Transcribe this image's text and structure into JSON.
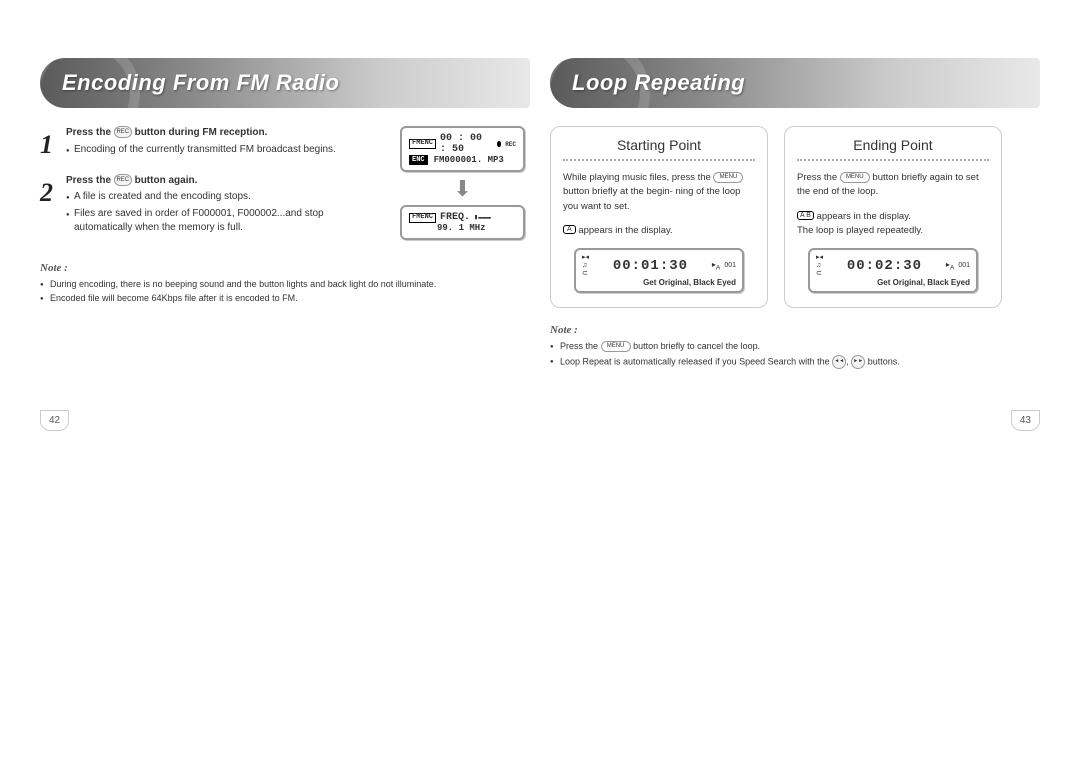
{
  "page_left": {
    "title": "Encoding From FM Radio",
    "step1_num": "1",
    "step1_bold_a": "Press the",
    "step1_btn": "REC",
    "step1_bold_b": "button during FM reception.",
    "step1_bullet1": "Encoding of the currently transmitted FM broadcast begins.",
    "step2_num": "2",
    "step2_bold_a": "Press the",
    "step2_btn": "REC",
    "step2_bold_b": "button again.",
    "step2_bullet1": "A file is created and the encoding stops.",
    "step2_bullet2": "Files are saved in order of F000001, F000002...and stop automatically when the memory is full.",
    "lcd1_badge1": "FMENC",
    "lcd1_time": "00 : 00 : 50",
    "lcd1_rec": "REC",
    "lcd1_badge2": "ENC",
    "lcd1_file": "FM000001. MP3",
    "lcd2_badge": "FMENC",
    "lcd2_freq_label": "FREQ.",
    "lcd2_freq": "99. 1  MHz",
    "note_title": "Note :",
    "note1": "During encoding, there is no beeping sound and the button lights and back light do not illuminate.",
    "note2": "Encoded file will become 64Kbps file after it is encoded to FM.",
    "page_num": "42"
  },
  "page_right": {
    "title": "Loop Repeating",
    "start": {
      "heading": "Starting Point",
      "text1a": "While playing music files, press the",
      "btn": "MENU",
      "text1b": "button briefly at the begin-",
      "text1c": "ning of the loop you want to set.",
      "badge": "A",
      "text2": "appears in the display.",
      "lcd_time": "00:01:30",
      "lcd_trk": "001",
      "lcd_track": "Get Original, Black Eyed"
    },
    "end": {
      "heading": "Ending Point",
      "text1a": "Press the",
      "btn": "MENU",
      "text1b": "button briefly",
      "text1c": "again to set the end of the loop.",
      "badge": "A B",
      "text2": "appears in the display.",
      "text3": "The loop is played repeatedly.",
      "lcd_time": "00:02:30",
      "lcd_trk": "001",
      "lcd_track": "Get Original, Black Eyed"
    },
    "note_title": "Note :",
    "note1a": "Press the",
    "note1_btn": "MENU",
    "note1b": "button briefly to cancel the loop.",
    "note2a": "Loop Repeat is automatically released if you Speed Search with the",
    "note2_btn1": "◄◄",
    "note2_btn2": "►►",
    "note2b": "buttons.",
    "page_num": "43"
  }
}
